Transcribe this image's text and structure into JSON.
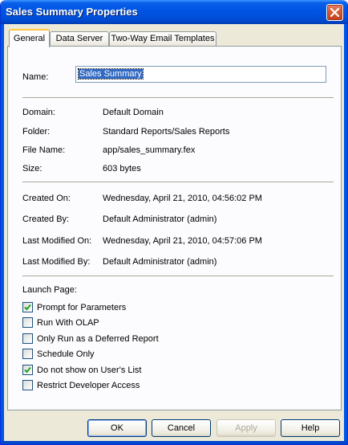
{
  "window": {
    "title": "Sales Summary Properties"
  },
  "tabs": [
    {
      "label": "General",
      "active": true
    },
    {
      "label": "Data Server",
      "active": false
    },
    {
      "label": "Two-Way Email Templates",
      "active": false
    }
  ],
  "general": {
    "name_label": "Name:",
    "name_value": "Sales Summary",
    "info": [
      {
        "label": "Domain:",
        "value": "Default Domain"
      },
      {
        "label": "Folder:",
        "value": "Standard Reports/Sales Reports"
      },
      {
        "label": "File Name:",
        "value": "app/sales_summary.fex"
      },
      {
        "label": "Size:",
        "value": "603 bytes"
      }
    ],
    "audit": [
      {
        "label": "Created On:",
        "value": "Wednesday, April 21, 2010, 04:56:02 PM"
      },
      {
        "label": "Created By:",
        "value": "Default Administrator (admin)"
      },
      {
        "label": "Last Modified On:",
        "value": "Wednesday, April 21, 2010, 04:57:06 PM"
      },
      {
        "label": "Last Modified By:",
        "value": "Default Administrator (admin)"
      }
    ],
    "launch_page_label": "Launch Page:",
    "options": [
      {
        "label": "Prompt for Parameters",
        "checked": true
      },
      {
        "label": "Run With OLAP",
        "checked": false
      },
      {
        "label": "Only Run as a Deferred Report",
        "checked": false
      },
      {
        "label": "Schedule Only",
        "checked": false
      },
      {
        "label": "Do not show on User's List",
        "checked": true
      },
      {
        "label": "Restrict Developer Access",
        "checked": false
      }
    ]
  },
  "buttons": {
    "ok": "OK",
    "cancel": "Cancel",
    "apply": "Apply",
    "help": "Help"
  },
  "colors": {
    "titlebar": "#0055e5",
    "dialog_bg": "#ece9d8",
    "selection": "#316ac5",
    "checkmark": "#21a121"
  }
}
